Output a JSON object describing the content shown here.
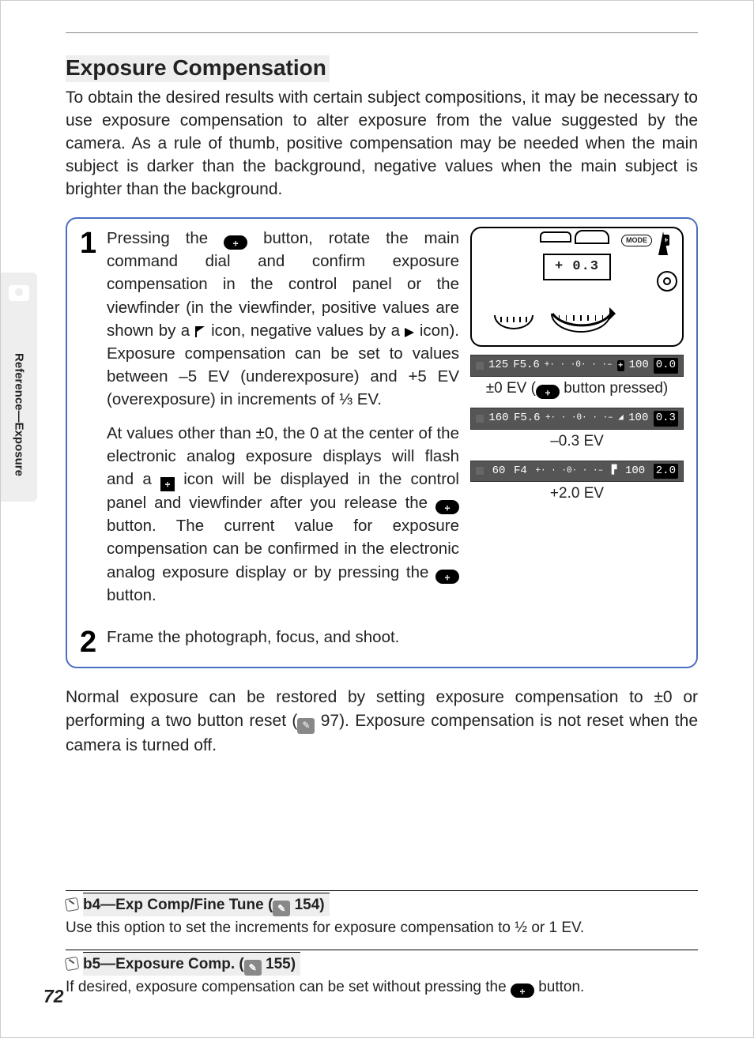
{
  "sideTab": "Reference—Exposure",
  "title": "Exposure Compensation",
  "intro": "To obtain the desired results with certain subject compositions, it may be necessary to use exposure compensation to alter exposure from the value suggested by the camera.  As a rule of thumb, positive compensation may be needed when the main subject is darker than the background, negative values when the main subject is brighter than the background.",
  "steps": {
    "s1": {
      "num": "1",
      "p1a": "Pressing the ",
      "p1b": " button, rotate the main command dial and confirm exposure compensation in the control panel or the viewfinder (in the viewfinder, positive values are shown by a ",
      "p1c": " icon, negative values by a ",
      "p1d": " icon).  Exposure compensation can be set to values between –5 EV (underexposure) and +5 EV (overexposure) in increments of ⅓ EV.",
      "p2a": "At values other than ±0, the 0 at the center of the electronic analog exposure displays will flash and a ",
      "p2b": " icon will be displayed in the control panel and viewfinder after you release the ",
      "p2c": " button.  The current value for exposure compensation can be confirmed in the electronic analog exposure display or by pressing the ",
      "p2d": " button."
    },
    "s2": {
      "num": "2",
      "text": "Frame the photograph, focus, and shoot."
    }
  },
  "fig": {
    "modeLabel": "MODE",
    "lcd": "+ 0.3",
    "strips": [
      {
        "left": "125",
        "mid": "F5.6",
        "scale": "+· · ·0· · ·–",
        "iso": "100",
        "right": "0.0"
      },
      {
        "left": "160",
        "mid": "F5.6",
        "scale": "+· · ·0· · ·–",
        "iso": "100",
        "right": "0.3"
      },
      {
        "left": "60",
        "mid": "F4",
        "scale": "+· · ·0· · ·–",
        "iso": "100",
        "right": "2.0"
      }
    ],
    "captions": {
      "c0a": "±0 EV (",
      "c0b": " button pressed)",
      "c1": "–0.3 EV",
      "c2": "+2.0 EV"
    }
  },
  "normal": {
    "a": "Normal exposure can be restored by setting exposure compensation to ±0 or performing a two button reset (",
    "ref": " 97",
    "b": ").  Exposure compensation is not reset when the camera is turned off."
  },
  "notes": {
    "n1": {
      "title_a": "b4—Exp Comp/Fine Tune (",
      "title_ref": " 154)",
      "body": "Use this option to set the increments for exposure compensation to ½ or 1 EV."
    },
    "n2": {
      "title_a": "b5—Exposure Comp. (",
      "title_ref": " 155)",
      "body_a": "If desired, exposure compensation can be set without pressing the ",
      "body_b": " button."
    }
  },
  "pageNumber": "72"
}
